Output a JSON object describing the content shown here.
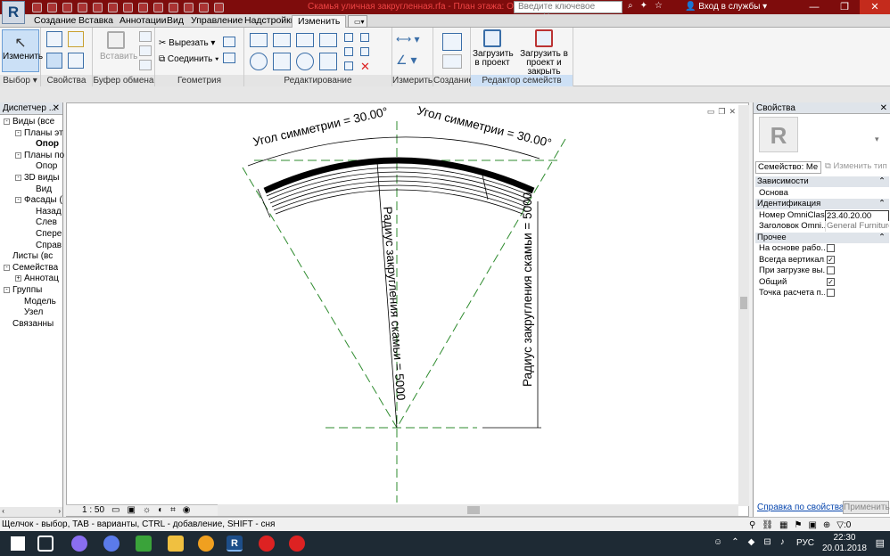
{
  "title_bar": {
    "logo": "R",
    "document_title": "Скамья уличная закругленная.rfa - План этажа: Опорн...",
    "search_placeholder": "Введите ключевое слово/фразу",
    "login": "Вход в службы",
    "accent_color": "#7e0c0c"
  },
  "tabs": [
    "Создание",
    "Вставка",
    "Аннотации",
    "Вид",
    "Управление",
    "Надстройки",
    "Изменить"
  ],
  "active_tab": "Изменить",
  "ribbon": {
    "modify_label": "Изменить",
    "paste_label": "Вставить",
    "cut_label": "Вырезать",
    "join_label": "Соединить",
    "load_project_label": "Загрузить в проект",
    "load_close_label": "Загрузить в проект и закрыть",
    "panels": {
      "select": "Выбор",
      "properties": "Свойства",
      "clipboard": "Буфер обмена",
      "geometry": "Геометрия",
      "modify": "Редактирование",
      "measure": "Измерить",
      "create": "Создание",
      "family_editor": "Редактор семейств"
    }
  },
  "browser": {
    "title": "Диспетчер ...",
    "items": [
      {
        "label": "Виды (все",
        "exp": "-"
      },
      {
        "label": "Планы эт",
        "exp": "-"
      },
      {
        "label": "Опор",
        "exp": ""
      },
      {
        "label": "Планы по",
        "exp": "-"
      },
      {
        "label": "Опор",
        "exp": ""
      },
      {
        "label": "3D виды",
        "exp": "-"
      },
      {
        "label": "Вид",
        "exp": ""
      },
      {
        "label": "Фасады (",
        "exp": "-"
      },
      {
        "label": "Назад",
        "exp": ""
      },
      {
        "label": "Слев",
        "exp": ""
      },
      {
        "label": "Спере",
        "exp": ""
      },
      {
        "label": "Справ",
        "exp": ""
      },
      {
        "label": "Листы (вс",
        "exp": ""
      },
      {
        "label": "Семейства",
        "exp": "-"
      },
      {
        "label": "Аннотац",
        "exp": "+"
      },
      {
        "label": "Группы",
        "exp": "-"
      },
      {
        "label": "Модель",
        "exp": ""
      },
      {
        "label": "Узел",
        "exp": ""
      },
      {
        "label": "Связанны",
        "exp": ""
      }
    ]
  },
  "drawing": {
    "angle_left": "Угол симметрии = 30.00°",
    "angle_right": "Угол симметрии = 30.00°",
    "radius_center": "Радиус закругления скамьи = 5000",
    "radius_right": "Радиус закругления скамьи = 5000"
  },
  "view_bar": {
    "scale": "1 : 50"
  },
  "properties": {
    "title": "Свойства",
    "family_label": "Семейство: Ме",
    "edit_type": "Изменить тип",
    "sections": [
      {
        "name": "Зависимости",
        "rows": [
          {
            "name": "Основа",
            "value": ""
          }
        ]
      },
      {
        "name": "Идентификация",
        "rows": [
          {
            "name": "Номер OmniClass",
            "value": "23.40.20.00"
          },
          {
            "name": "Заголовок Omni...",
            "value": "General Furniture ..."
          }
        ]
      },
      {
        "name": "Прочее",
        "rows": [
          {
            "name": "На основе рабо...",
            "checked": false
          },
          {
            "name": "Всегда вертикал...",
            "checked": true
          },
          {
            "name": "При загрузке вы...",
            "checked": false
          },
          {
            "name": "Общий",
            "checked": true
          },
          {
            "name": "Точка расчета п...",
            "checked": false
          }
        ]
      }
    ],
    "help_link": "Справка по свойствам",
    "apply_button": "Применить"
  },
  "status_bar": "Щелчок - выбор, TAB - варианты, CTRL - добавление, SHIFT - сня",
  "taskbar": {
    "lang": "РУС",
    "time": "22:30",
    "date": "20.01.2018"
  }
}
